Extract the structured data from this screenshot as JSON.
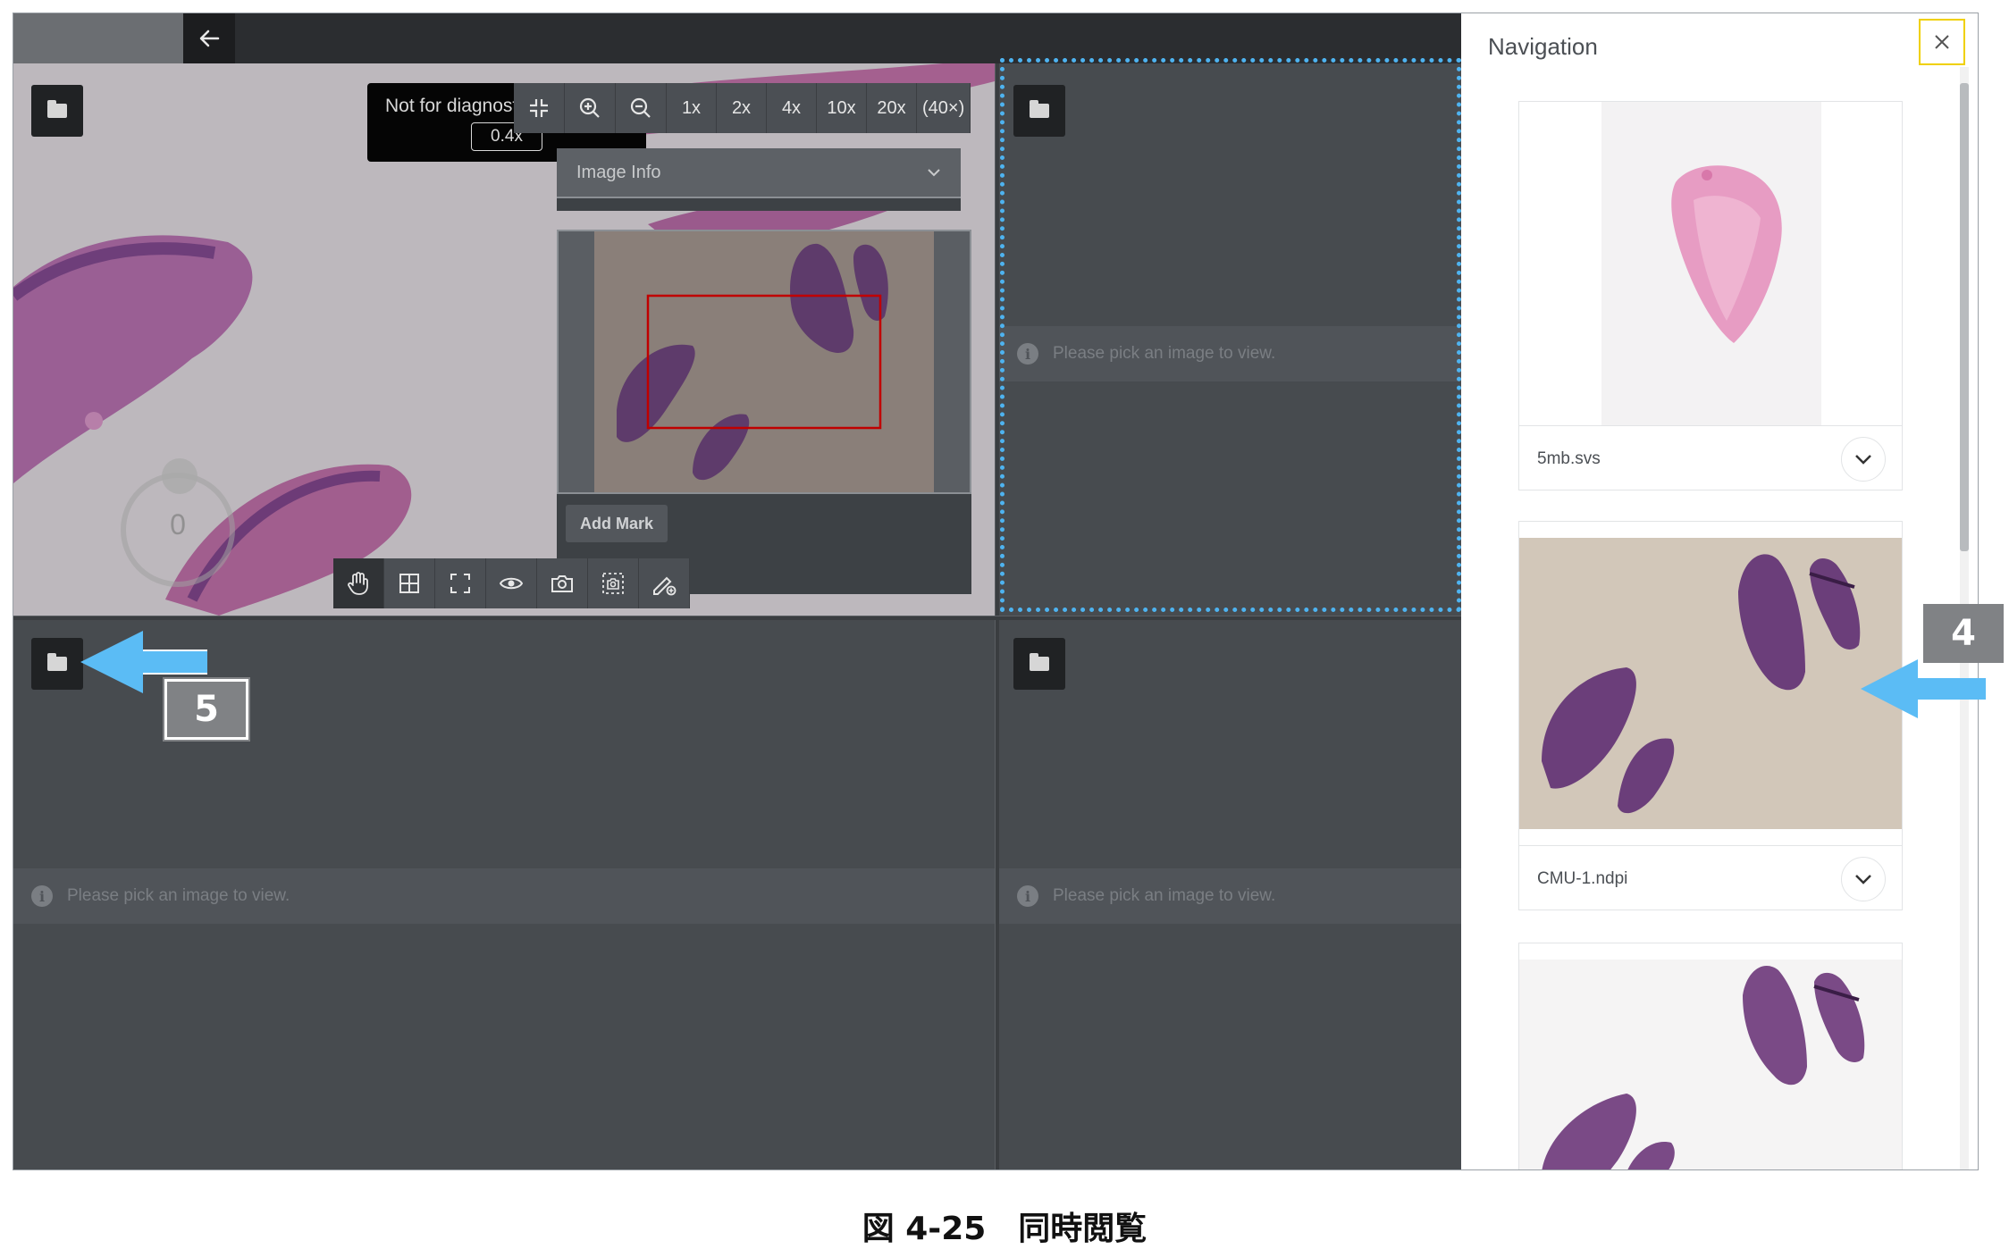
{
  "app": {
    "back_icon": "arrow-left-icon"
  },
  "viewer": {
    "not_for_diagnosis": "Not for diagnost",
    "zoom_value": "0.4x",
    "zoom_buttons": [
      "1x",
      "2x",
      "4x",
      "10x",
      "20x",
      "(40×)"
    ],
    "zoom_icons": [
      "fit-screen-icon",
      "zoom-in-icon",
      "zoom-out-icon"
    ],
    "image_info_label": "Image Info",
    "add_mark_label": "Add Mark",
    "rotation_value": "0",
    "bottom_tools": [
      "pan-hand-icon",
      "grid-icon",
      "fullscreen-icon",
      "eye-icon",
      "camera-icon",
      "region-capture-icon",
      "annotate-pen-icon"
    ]
  },
  "empty_pane": {
    "message": "Please pick an image to view."
  },
  "navigation": {
    "title": "Navigation",
    "close_icon": "close-icon",
    "items": [
      {
        "name": "5mb.svs"
      },
      {
        "name": "CMU-1.ndpi"
      },
      {
        "name": ""
      }
    ]
  },
  "callouts": {
    "four": "4",
    "five": "5",
    "arrow_color": "#5bbcf5"
  },
  "caption": "図 4-25　同時閲覧",
  "colors": {
    "selection_border": "#4eb3f0",
    "close_highlight": "#f0d000",
    "minimap_box": "#c00000"
  }
}
